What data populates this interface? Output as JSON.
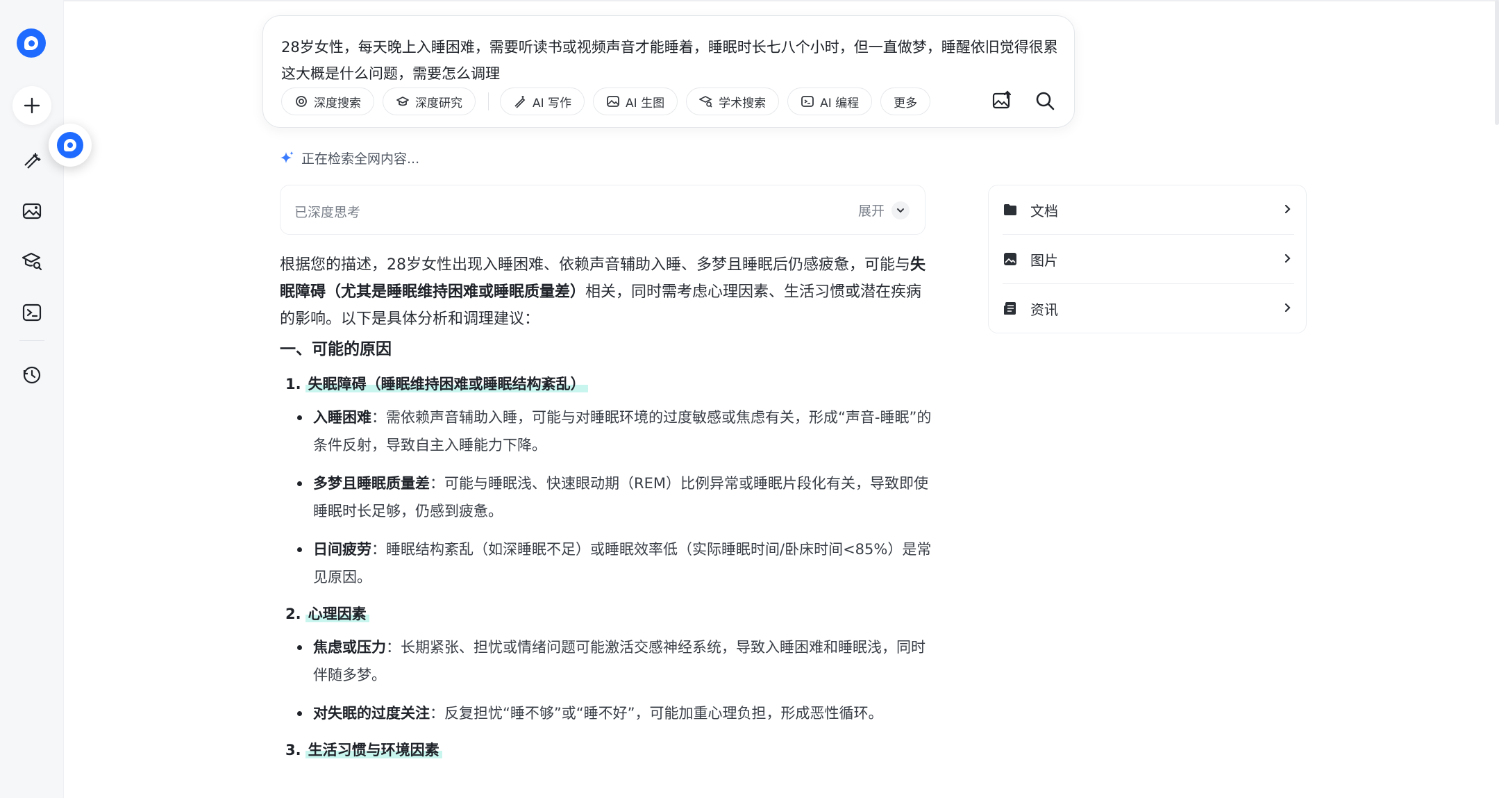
{
  "query": {
    "text": "28岁女性，每天晚上入睡困难，需要听读书或视频声音才能睡着，睡眠时长七八个小时，但一直做梦，睡醒依旧觉得很累 这大概是什么问题，需要怎么调理"
  },
  "tools": [
    {
      "label": "深度搜索",
      "icon": "deep-search-icon"
    },
    {
      "label": "深度研究",
      "icon": "deep-research-icon"
    },
    {
      "label": "AI 写作",
      "icon": "ai-write-icon"
    },
    {
      "label": "AI 生图",
      "icon": "ai-image-icon"
    },
    {
      "label": "学术搜索",
      "icon": "academic-search-icon"
    },
    {
      "label": "AI 编程",
      "icon": "ai-code-icon"
    },
    {
      "label": "更多",
      "icon": ""
    }
  ],
  "status": {
    "text": "正在检索全网内容..."
  },
  "think": {
    "label": "已深度思考",
    "expand_label": "展开"
  },
  "answer": {
    "intro_a": "根据您的描述，28岁女性出现入睡困难、依赖声音辅助入睡、多梦且睡眠后仍感疲惫，可能与",
    "intro_bold": "失眠障碍（尤其是睡眠维持困难或睡眠质量差）",
    "intro_b": "相关，同时需考虑心理因素、生活习惯或潜在疾病的影响。以下是具体分析和调理建议：",
    "section_title": "一、可能的原因",
    "groups": [
      {
        "num": "1.",
        "title": "失眠障碍（睡眠维持困难或睡眠结构紊乱）",
        "items": [
          {
            "term": "入睡困难",
            "text": "：需依赖声音辅助入睡，可能与对睡眠环境的过度敏感或焦虑有关，形成“声音-睡眠”的条件反射，导致自主入睡能力下降。"
          },
          {
            "term": "多梦且睡眠质量差",
            "text": "：可能与睡眠浅、快速眼动期（REM）比例异常或睡眠片段化有关，导致即使睡眠时长足够，仍感到疲惫。"
          },
          {
            "term": "日间疲劳",
            "text": "：睡眠结构紊乱（如深睡眠不足）或睡眠效率低（实际睡眠时间/卧床时间<85%）是常见原因。"
          }
        ]
      },
      {
        "num": "2.",
        "title": "心理因素",
        "items": [
          {
            "term": "焦虑或压力",
            "text": "：长期紧张、担忧或情绪问题可能激活交感神经系统，导致入睡困难和睡眠浅，同时伴随多梦。"
          },
          {
            "term": "对失眠的过度关注",
            "text": "：反复担忧“睡不够”或“睡不好”，可能加重心理负担，形成恶性循环。"
          }
        ]
      },
      {
        "num": "3.",
        "title": "生活习惯与环境因素",
        "items": []
      }
    ]
  },
  "side_panel": {
    "items": [
      {
        "label": "文档",
        "icon": "folder-icon"
      },
      {
        "label": "图片",
        "icon": "image-icon"
      },
      {
        "label": "资讯",
        "icon": "news-icon"
      }
    ]
  }
}
